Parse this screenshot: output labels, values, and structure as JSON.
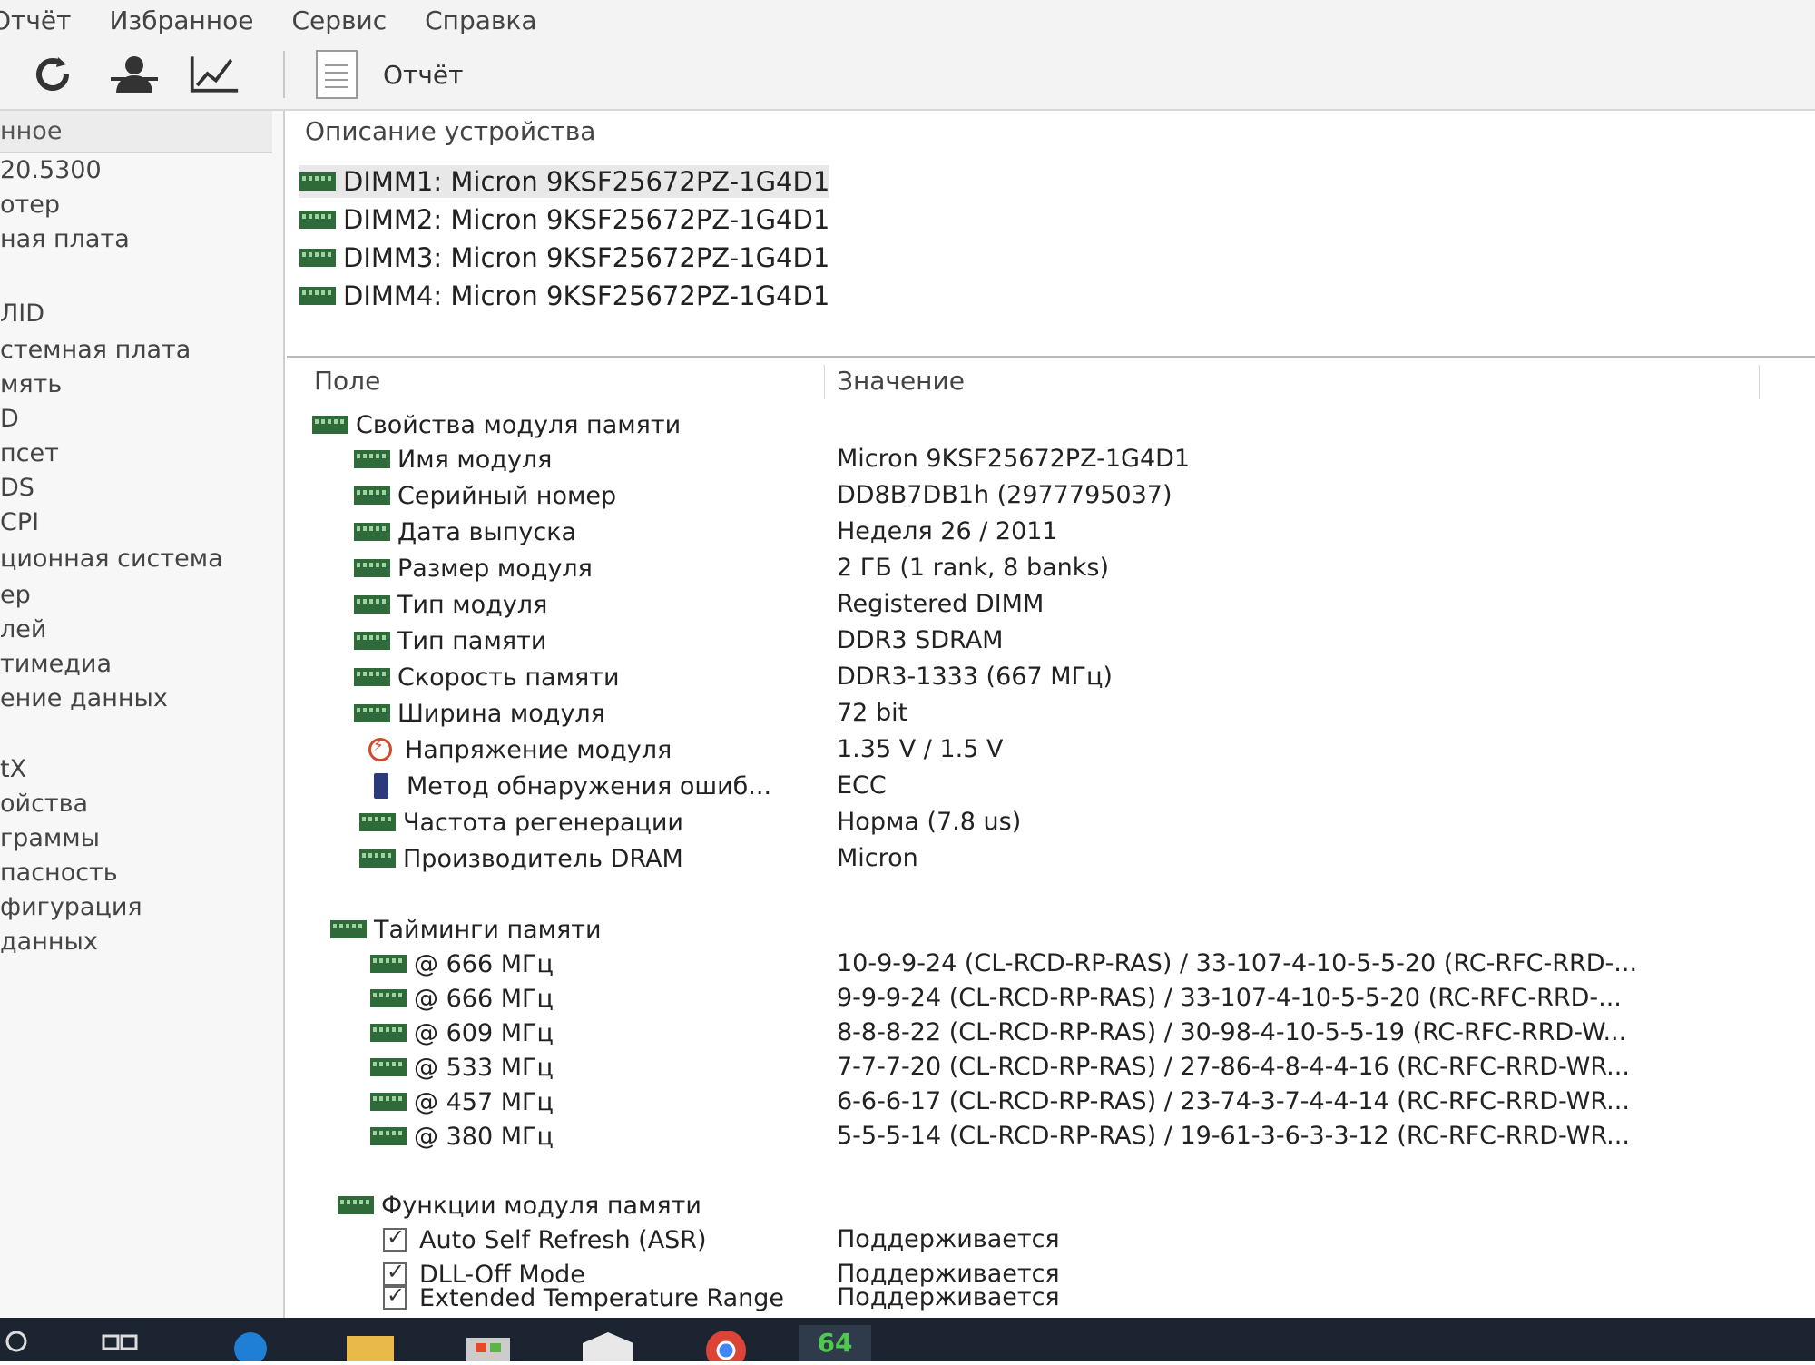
{
  "menu": [
    "Отчёт",
    "Избранное",
    "Сервис",
    "Справка"
  ],
  "toolbar": {
    "report_label": "Отчёт"
  },
  "sidebar": {
    "header": "нное",
    "items": [
      "20.5300",
      "отер",
      "ная плата",
      "ЛID",
      "стемная плата",
      "мять",
      "D",
      "псет",
      "DS",
      "CPI",
      "ционная система",
      "ер",
      "лей",
      "тимедиа",
      "ение данных",
      "tX",
      "ойства",
      "граммы",
      "пасность",
      "фигурация",
      "данных"
    ]
  },
  "device": {
    "header": "Описание устройства",
    "dimms": [
      "DIMM1: Micron 9KSF25672PZ-1G4D1",
      "DIMM2: Micron 9KSF25672PZ-1G4D1",
      "DIMM3: Micron 9KSF25672PZ-1G4D1",
      "DIMM4: Micron 9KSF25672PZ-1G4D1"
    ]
  },
  "table": {
    "col_field": "Поле",
    "col_value": "Значение",
    "group_props": "Свойства модуля памяти",
    "props": [
      {
        "field": "Имя модуля",
        "value": "Micron 9KSF25672PZ-1G4D1",
        "icon": "ram-icon"
      },
      {
        "field": "Серийный номер",
        "value": "DD8B7DB1h (2977795037)",
        "icon": "ram-icon"
      },
      {
        "field": "Дата выпуска",
        "value": "Неделя 26 / 2011",
        "icon": "ram-icon"
      },
      {
        "field": "Размер модуля",
        "value": "2 ГБ (1 rank, 8 banks)",
        "icon": "ram-icon"
      },
      {
        "field": "Тип модуля",
        "value": "Registered DIMM",
        "icon": "ram-icon"
      },
      {
        "field": "Тип памяти",
        "value": "DDR3 SDRAM",
        "icon": "ram-icon"
      },
      {
        "field": "Скорость памяти",
        "value": "DDR3-1333 (667 МГц)",
        "icon": "ram-icon"
      },
      {
        "field": "Ширина модуля",
        "value": "72 bit",
        "icon": "ram-icon"
      },
      {
        "field": "Напряжение модуля",
        "value": "1.35 V / 1.5 V",
        "icon": "voltage-icon"
      },
      {
        "field": "Метод обнаружения ошиб...",
        "value": "ECC",
        "icon": "chip-icon"
      },
      {
        "field": "Частота регенерации",
        "value": "Норма (7.8 us)",
        "icon": "ram-icon"
      },
      {
        "field": "Производитель DRAM",
        "value": "Micron",
        "icon": "ram-icon"
      }
    ],
    "group_timings": "Тайминги памяти",
    "timings": [
      {
        "field": "@ 666 МГц",
        "value": "10-9-9-24  (CL-RCD-RP-RAS) / 33-107-4-10-5-5-20  (RC-RFC-RRD-..."
      },
      {
        "field": "@ 666 МГц",
        "value": "9-9-9-24  (CL-RCD-RP-RAS) / 33-107-4-10-5-5-20  (RC-RFC-RRD-..."
      },
      {
        "field": "@ 609 МГц",
        "value": "8-8-8-22  (CL-RCD-RP-RAS) / 30-98-4-10-5-5-19  (RC-RFC-RRD-W..."
      },
      {
        "field": "@ 533 МГц",
        "value": "7-7-7-20  (CL-RCD-RP-RAS) / 27-86-4-8-4-4-16  (RC-RFC-RRD-WR..."
      },
      {
        "field": "@ 457 МГц",
        "value": "6-6-6-17  (CL-RCD-RP-RAS) / 23-74-3-7-4-4-14  (RC-RFC-RRD-WR..."
      },
      {
        "field": "@ 380 МГц",
        "value": "5-5-5-14  (CL-RCD-RP-RAS) / 19-61-3-6-3-3-12  (RC-RFC-RRD-WR..."
      }
    ],
    "group_features": "Функции модуля памяти",
    "features": [
      {
        "field": "Auto Self Refresh (ASR)",
        "value": "Поддерживается"
      },
      {
        "field": "DLL-Off Mode",
        "value": "Поддерживается"
      },
      {
        "field": "Extended Temperature Range",
        "value": "Поддерживается"
      }
    ]
  },
  "taskbar": {
    "apps": [
      "search-icon",
      "task-view-icon",
      "edge-icon",
      "file-explorer-icon",
      "store-icon",
      "mail-icon",
      "chrome-icon",
      "aida64-icon"
    ],
    "aida_label": "64"
  },
  "colors": {
    "ram_green": "#2f6b3a",
    "taskbar": "#1b2430",
    "selection": "#e8e8e8"
  }
}
